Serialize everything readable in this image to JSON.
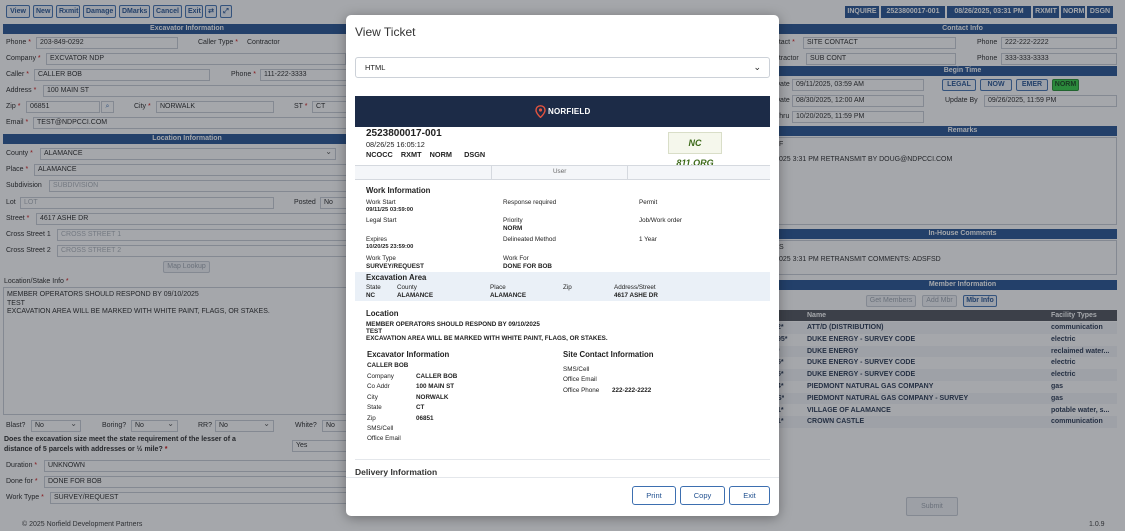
{
  "toolbar": {
    "view": "View",
    "new": "New",
    "rxmit": "Rxmit",
    "damage": "Damage",
    "dmarks": "DMarks",
    "cancel": "Cancel",
    "exit": "Exit"
  },
  "info_bar": {
    "type": "INQUIRE",
    "ticket": "2523800017-001",
    "datetime": "08/26/2025, 03:31 PM",
    "rxmit": "RXMIT",
    "priority": "NORM",
    "kind": "DSGN"
  },
  "excavator": {
    "header": "Excavator Information",
    "phone_label": "Phone",
    "phone": "203-849-0292",
    "caller_type_label": "Caller Type",
    "caller_type": "Contractor",
    "company_label": "Company",
    "company": "EXCVATOR NDP",
    "caller_label": "Caller",
    "caller": "CALLER BOB",
    "phone2_label": "Phone",
    "phone2": "111-222-3333",
    "address_label": "Address",
    "address": "100 MAIN ST",
    "zip_label": "Zip",
    "zip": "06851",
    "city_label": "City",
    "city": "NORWALK",
    "st_label": "ST",
    "st": "CT",
    "email_label": "Email",
    "email": "TEST@NDPCCI.COM"
  },
  "location": {
    "header": "Location Information",
    "county_label": "County",
    "county": "ALAMANCE",
    "place_label": "Place",
    "place": "ALAMANCE",
    "subdivision_label": "Subdivision",
    "subdivision_ph": "SUBDIVISION",
    "lot_label": "Lot",
    "lot_ph": "LOT",
    "posted_label": "Posted",
    "posted": "No",
    "street_label": "Street",
    "street": "4617 ASHE DR",
    "cross1_label": "Cross Street 1",
    "cross1_ph": "CROSS STREET 1",
    "cross2_label": "Cross Street 2",
    "cross2_ph": "CROSS STREET 2",
    "map_lookup": "Map Lookup",
    "stake_label": "Location/Stake Info",
    "stake_text": "MEMBER OPERATORS SHOULD RESPOND BY 09/10/2025\nTEST\nEXCAVATION AREA WILL BE MARKED WITH WHITE PAINT, FLAGS, OR STAKES.",
    "blast_label": "Blast?",
    "blast": "No",
    "boring_label": "Boring?",
    "boring": "No",
    "rr_label": "RR?",
    "rr": "No",
    "white_label": "White?",
    "white": "No",
    "size_question": "Does the excavation size meet the state requirement of the lesser of a distance of 5 parcels with addresses or ½ mile?",
    "size_answer": "Yes",
    "duration_label": "Duration",
    "duration": "UNKNOWN",
    "donefor_label": "Done for",
    "donefor": "DONE FOR BOB",
    "worktype_label": "Work Type",
    "worktype": "SURVEY/REQUEST"
  },
  "contact": {
    "header": "Contact Info",
    "contact_label": "Contact",
    "contact": "SITE CONTACT",
    "phone_label": "Phone",
    "phone": "222-222-2222",
    "contractor_label": "Contractor",
    "contractor": "SUB CONT",
    "phone2_label": "Phone",
    "phone2": "333-333-3333"
  },
  "begin_time": {
    "header": "Begin Time",
    "date_label": "Date",
    "date": "09/11/2025, 03:59 AM",
    "date2_label": "Date",
    "date2": "08/30/2025, 12:00 AM",
    "thru_label": "Thru",
    "thru": "10/20/2025, 11:59 PM",
    "legal": "LEGAL",
    "now": "NOW",
    "emer": "EMER",
    "norm": "NORM",
    "update_label": "Update By",
    "update": "09/26/2025, 11:59 PM"
  },
  "remarks": {
    "header": "Remarks",
    "line1": "F",
    "line2": "025 3:31 PM RETRANSMIT BY DOUG@NDPCCI.COM"
  },
  "inhouse": {
    "header": "In-House Comments",
    "line1": "S",
    "line2": "025 3:31 PM RETRANSMIT COMMENTS: ADSFSD"
  },
  "members": {
    "header": "Member Information",
    "get_members": "Get Members",
    "add_mbr": "Add Mbr",
    "mbr_info": "Mbr Info",
    "col_name": "Name",
    "col_facility": "Facility Types",
    "rows": [
      {
        "code": "2*",
        "name": "ATT/D (DISTRIBUTION)",
        "facility": "communication"
      },
      {
        "code": "95*",
        "name": "DUKE ENERGY - SURVEY CODE",
        "facility": "electric"
      },
      {
        "code": "*",
        "name": "DUKE ENERGY",
        "facility": "reclaimed water..."
      },
      {
        "code": "5*",
        "name": "DUKE ENERGY - SURVEY CODE",
        "facility": "electric"
      },
      {
        "code": "5*",
        "name": "DUKE ENERGY - SURVEY CODE",
        "facility": "electric"
      },
      {
        "code": "4*",
        "name": "PIEDMONT NATURAL GAS COMPANY",
        "facility": "gas"
      },
      {
        "code": "S*",
        "name": "PIEDMONT NATURAL GAS COMPANY - SURVEY",
        "facility": "gas"
      },
      {
        "code": "1*",
        "name": "VILLAGE OF ALAMANCE",
        "facility": "potable water, s..."
      },
      {
        "code": "1*",
        "name": "CROWN CASTLE",
        "facility": "communication"
      }
    ],
    "submit": "Submit"
  },
  "footer": {
    "copyright": "© 2025 Norfield Development Partners",
    "version": "1.0.9"
  },
  "modal": {
    "title": "View Ticket",
    "format": "HTML",
    "brand": "NORFIELD",
    "badge": "NC 811.ORG",
    "ticket_no": "2523800017-001",
    "ticket_dt": "08/26/25 16:05:12",
    "codes": "NCOCC    RXMT    NORM      DSGN",
    "user_label": "User",
    "work_header": "Work Information",
    "work_start_label": "Work Start",
    "work_start": "09/11/25 03:59:00",
    "response_label": "Response required",
    "permit_label": "Permit",
    "legal_start_label": "Legal Start",
    "priority_label": "Priority",
    "priority": "NORM",
    "job_label": "Job/Work order",
    "expires_label": "Expires",
    "expires": "10/20/25 23:59:00",
    "delineated_label": "Delineated Method",
    "delineated": "1 Year",
    "worktype_label": "Work Type",
    "worktype": "SURVEY/REQUEST",
    "workfor_label": "Work For",
    "workfor": "DONE FOR BOB",
    "exc_area": "Excavation Area",
    "state_label": "State",
    "state": "NC",
    "county_label": "County",
    "county": "ALAMANCE",
    "place_label": "Place",
    "place": "ALAMANCE",
    "zip_label": "Zip",
    "addr_label": "Address/Street",
    "addr": "4617 ASHE DR",
    "location_header": "Location",
    "location_l1": "MEMBER OPERATORS SHOULD RESPOND BY 09/10/2025",
    "location_l2": "TEST",
    "location_l3": "EXCAVATION AREA WILL BE MARKED WITH WHITE PAINT, FLAGS, OR STAKES.",
    "excavator_header": "Excavator Information",
    "exc_name": "CALLER BOB",
    "company_label": "Company",
    "company": "CALLER BOB",
    "coaddr_label": "Co Addr",
    "coaddr": "100 MAIN ST",
    "city_label": "City",
    "city": "NORWALK",
    "st_label": "State",
    "st": "CT",
    "zip2_label": "Zip",
    "zip2": "06851",
    "sms_label": "SMS/Cell",
    "email_label": "Office Email",
    "site_header": "Site Contact Information",
    "site_sms_label": "SMS/Cell",
    "site_email_label": "Office Email",
    "site_phone_label": "Office Phone",
    "site_phone": "222-222-2222",
    "delivery": "Delivery Information",
    "print": "Print",
    "copy": "Copy",
    "exit": "Exit"
  },
  "colors": {
    "primary": "#1f4f8f",
    "norm_green": "#2ecc40",
    "brand_dark": "#1c2b47"
  }
}
